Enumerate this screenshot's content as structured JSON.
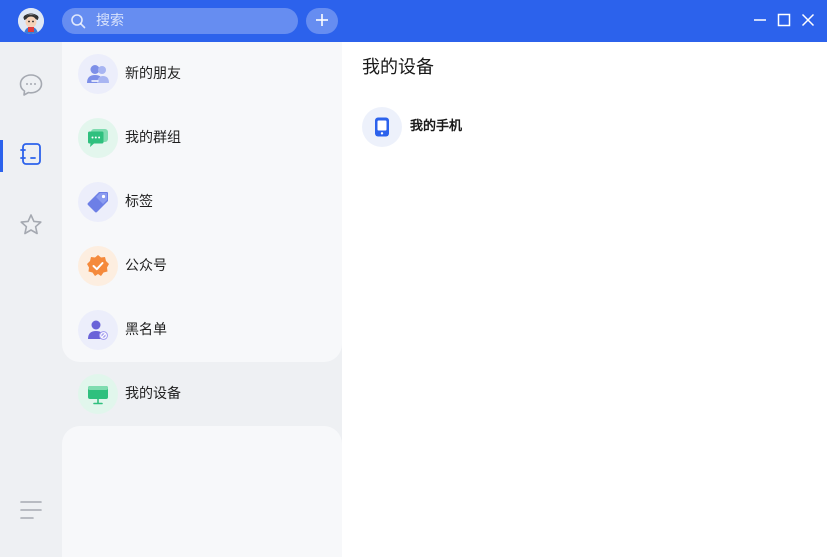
{
  "colors": {
    "titlebar": "#2c62ec",
    "accent": "#2c62ec",
    "sidebar_bg": "#eef0f3",
    "panel_bg": "#f7f8fa"
  },
  "header": {
    "avatar_icon": "user-avatar",
    "search": {
      "placeholder": "搜索",
      "value": ""
    },
    "add_icon": "plus-icon",
    "window_controls": [
      "minimize-icon",
      "maximize-icon",
      "close-icon"
    ]
  },
  "sidebar": {
    "items": [
      {
        "icon": "chat-bubble-icon",
        "active": false
      },
      {
        "icon": "contacts-book-icon",
        "active": true
      },
      {
        "icon": "star-icon",
        "active": false
      }
    ],
    "menu_icon": "menu-icon"
  },
  "contacts": {
    "items": [
      {
        "label": "新的朋友",
        "icon": "new-friends-icon"
      },
      {
        "label": "我的群组",
        "icon": "groups-icon"
      },
      {
        "label": "标签",
        "icon": "tag-icon"
      },
      {
        "label": "公众号",
        "icon": "official-account-icon"
      },
      {
        "label": "黑名单",
        "icon": "blacklist-icon"
      },
      {
        "label": "我的设备",
        "icon": "devices-icon",
        "selected": true
      }
    ]
  },
  "main": {
    "title": "我的设备",
    "devices": [
      {
        "label": "我的手机",
        "icon": "phone-icon"
      }
    ]
  }
}
